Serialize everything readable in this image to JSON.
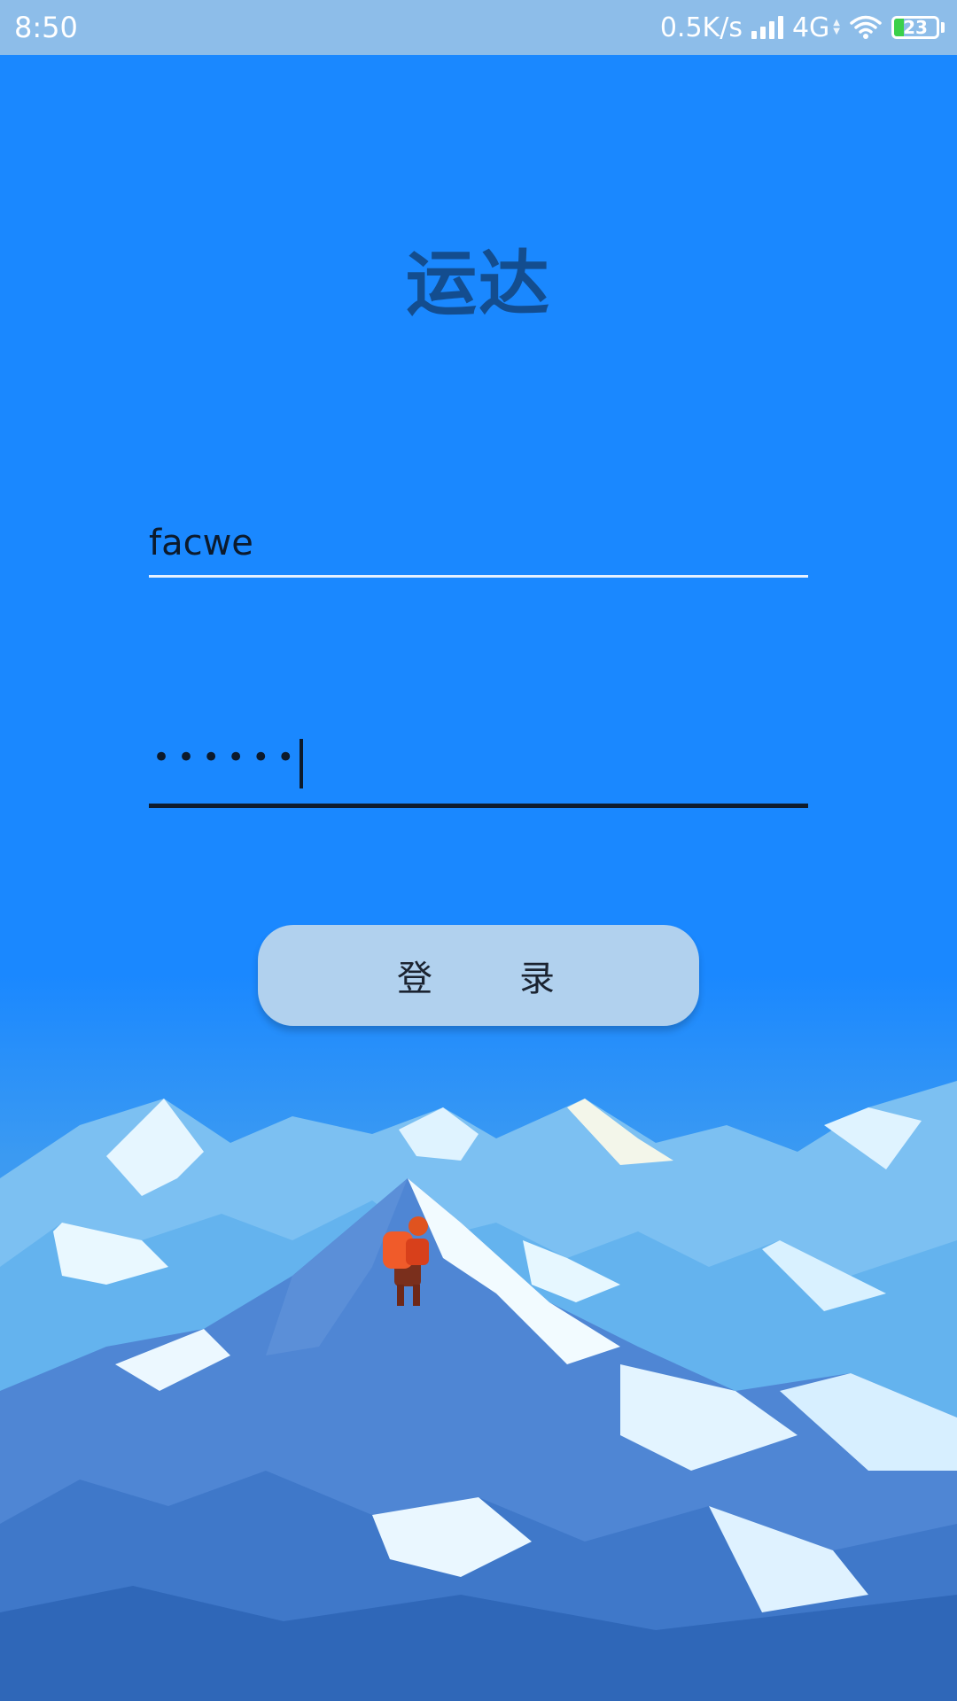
{
  "status_bar": {
    "time": "8:50",
    "speed": "0.5K/s",
    "network": "4G",
    "battery_level": "23",
    "battery_fraction": 0.23,
    "icons": [
      "signal-icon",
      "wifi-icon",
      "battery-icon"
    ]
  },
  "app": {
    "title": "运达"
  },
  "login": {
    "username_value": "facwe",
    "password_masked": "••••••",
    "button_label": "登　　录"
  },
  "colors": {
    "background": "#1a88ff",
    "status_bar": "#8dbde9",
    "title": "#134d8f",
    "button": "#b1d1ee",
    "battery_fill": "#3ad04a"
  },
  "illustration": {
    "name": "mountain-climber-illustration"
  }
}
